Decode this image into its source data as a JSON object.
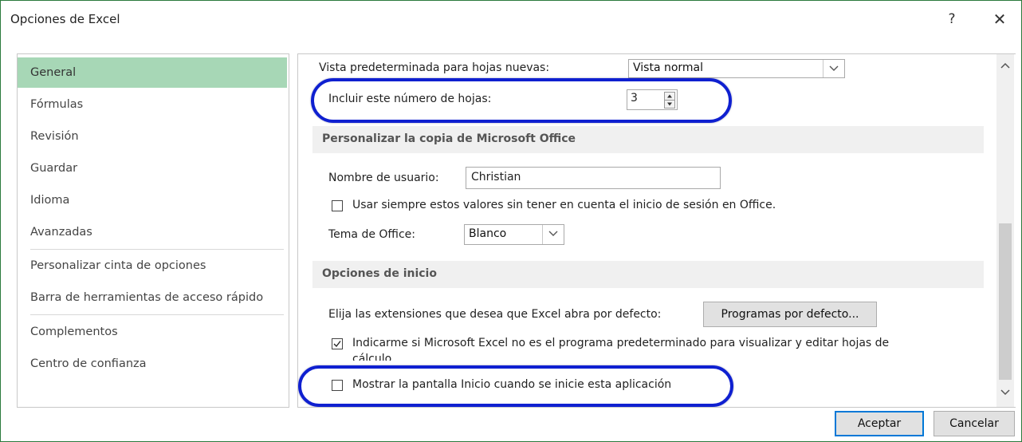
{
  "window": {
    "title": "Opciones de Excel",
    "help_glyph": "?",
    "close_glyph": "✕"
  },
  "sidebar": {
    "items": [
      {
        "label": "General",
        "selected": true
      },
      {
        "label": "Fórmulas"
      },
      {
        "label": "Revisión"
      },
      {
        "label": "Guardar"
      },
      {
        "label": "Idioma"
      },
      {
        "label": "Avanzadas"
      },
      {
        "label": "Personalizar cinta de opciones"
      },
      {
        "label": "Barra de herramientas de acceso rápido"
      },
      {
        "label": "Complementos"
      },
      {
        "label": "Centro de confianza"
      }
    ]
  },
  "content": {
    "default_view_label": "Vista predeterminada para hojas nuevas:",
    "default_view_value": "Vista normal",
    "sheets_label": "Incluir este número de hojas:",
    "sheets_value": "3",
    "section_personalize": "Personalizar la copia de Microsoft Office",
    "username_label": "Nombre de usuario:",
    "username_value": "Christian",
    "always_use_label": "Usar siempre estos valores sin tener en cuenta el inicio de sesión en Office.",
    "always_use_checked": false,
    "theme_label": "Tema de Office:",
    "theme_value": "Blanco",
    "section_startup": "Opciones de inicio",
    "extensions_label": "Elija las extensiones que desea que Excel abra por defecto:",
    "default_programs_button": "Programas por defecto...",
    "notify_default_label": "Indicarme si Microsoft Excel no es el programa predeterminado para visualizar y editar hojas de",
    "notify_default_label_line2": "cálculo.",
    "notify_default_checked": true,
    "show_start_screen_label": "Mostrar la pantalla Inicio cuando se inicie esta aplicación",
    "show_start_screen_checked": false
  },
  "footer": {
    "ok_label": "Aceptar",
    "cancel_label": "Cancelar"
  },
  "colors": {
    "selected_nav": "#a7d7b6",
    "highlight_oval": "#0f20d0",
    "window_border": "#2b7a3d",
    "primary_button_border": "#0078d7"
  }
}
